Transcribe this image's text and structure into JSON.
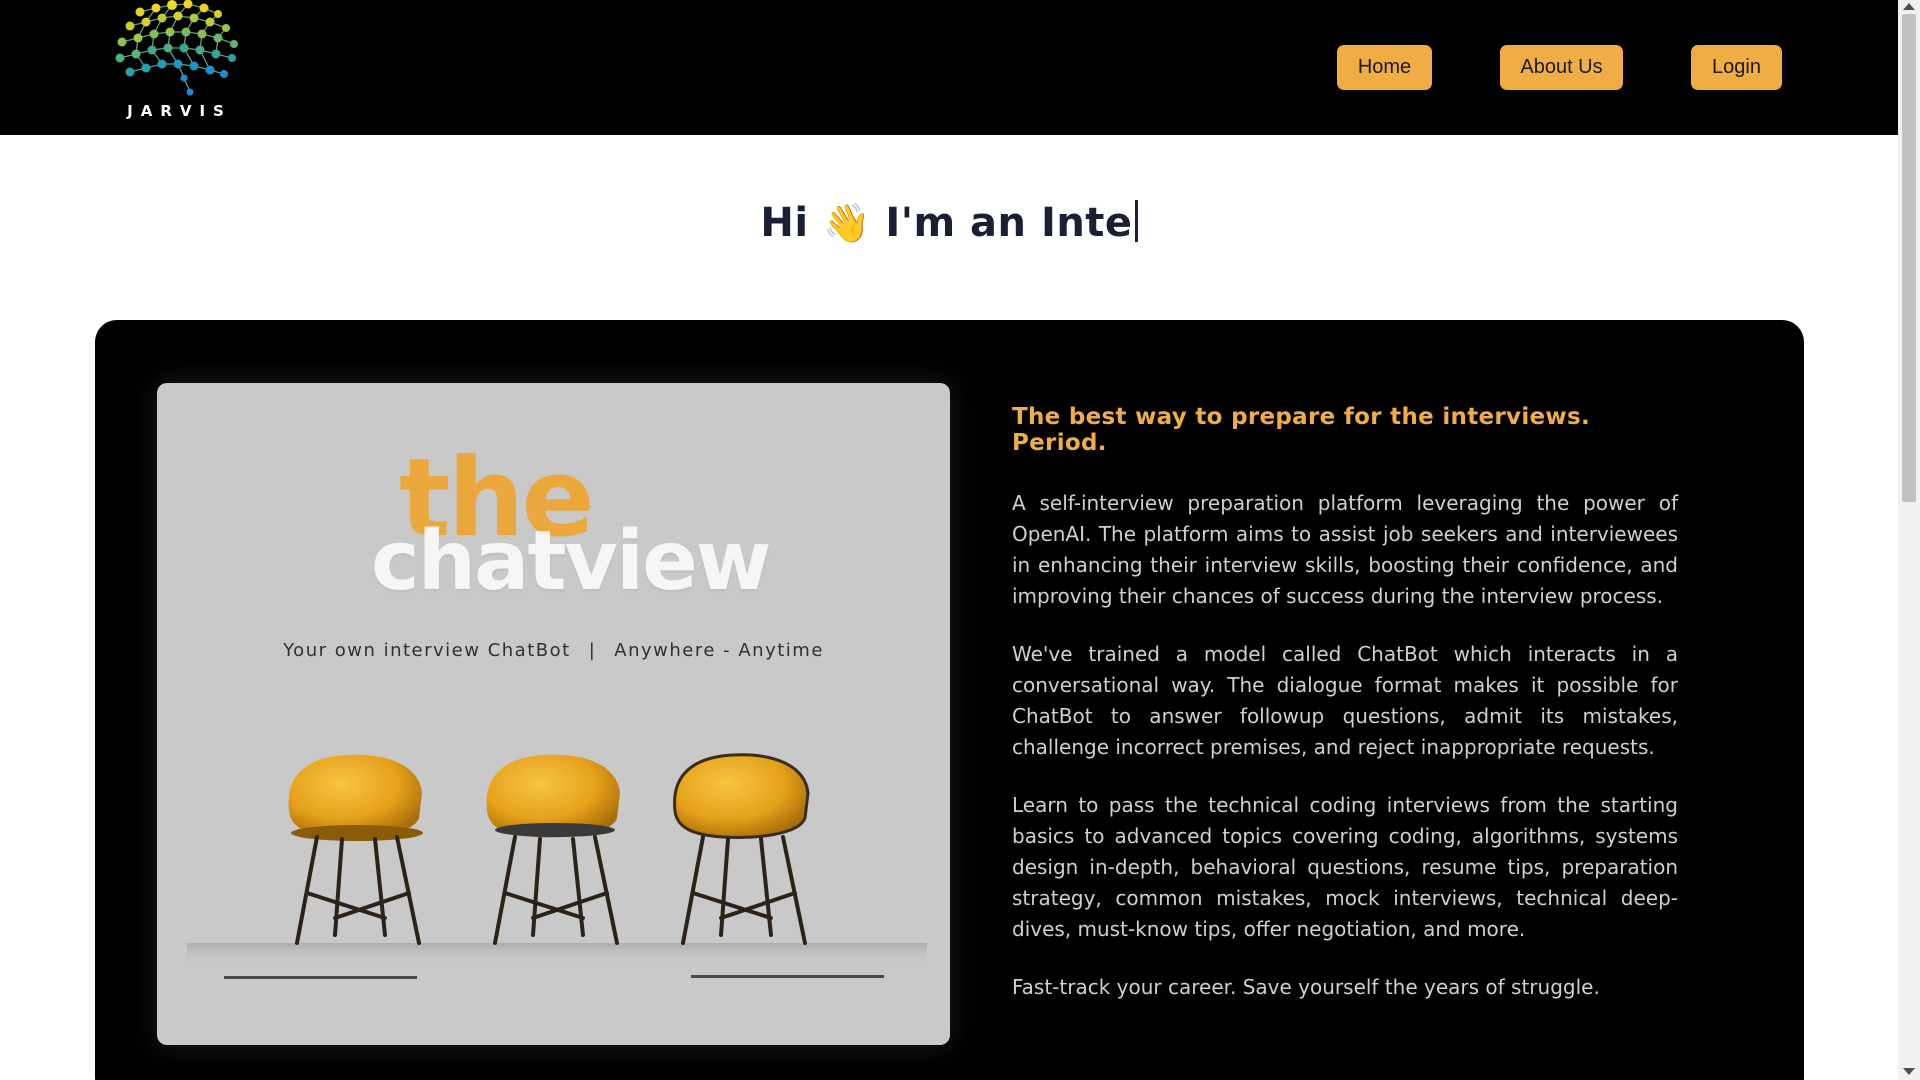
{
  "header": {
    "logo_text": "JARVIS",
    "nav": {
      "home": "Home",
      "about": "About Us",
      "login": "Login"
    }
  },
  "hero": {
    "greeting": "Hi",
    "wave_emoji": "👋",
    "typed_text": "I'm an Inte"
  },
  "card": {
    "image": {
      "brand_top": "the",
      "brand_bottom": "chatview",
      "tagline_left": "Your own interview ChatBot",
      "tagline_separator": "|",
      "tagline_right": "Anywhere - Anytime"
    },
    "headline": "The best way to prepare for the interviews. Period.",
    "paragraphs": [
      "A self-interview preparation platform leveraging the power of OpenAI. The platform aims to assist job seekers and interviewees in enhancing their interview skills, boosting their confidence, and improving their chances of success during the interview process.",
      "We've trained a model called ChatBot which interacts in a conversational way. The dialogue format makes it possible for ChatBot to answer followup questions, admit its mistakes, challenge incorrect premises, and reject inappropriate requests.",
      "Learn to pass the technical coding interviews from the starting basics to advanced topics covering coding, algorithms, systems design in-depth, behavioral questions, resume tips, preparation strategy, common mistakes, mock interviews, technical deep-dives, must-know tips, offer negotiation, and more.",
      "Fast-track your career. Save yourself the years of struggle."
    ]
  },
  "colors": {
    "accent": "#f0ad45",
    "background_dark": "#000000",
    "image_panel": "#c9c9c9",
    "body_text": "#cfcfcf",
    "heading_text": "#1a1f36"
  },
  "icons": [
    "brain-network-logo-icon",
    "wave-hand-icon",
    "chair-illustration"
  ]
}
